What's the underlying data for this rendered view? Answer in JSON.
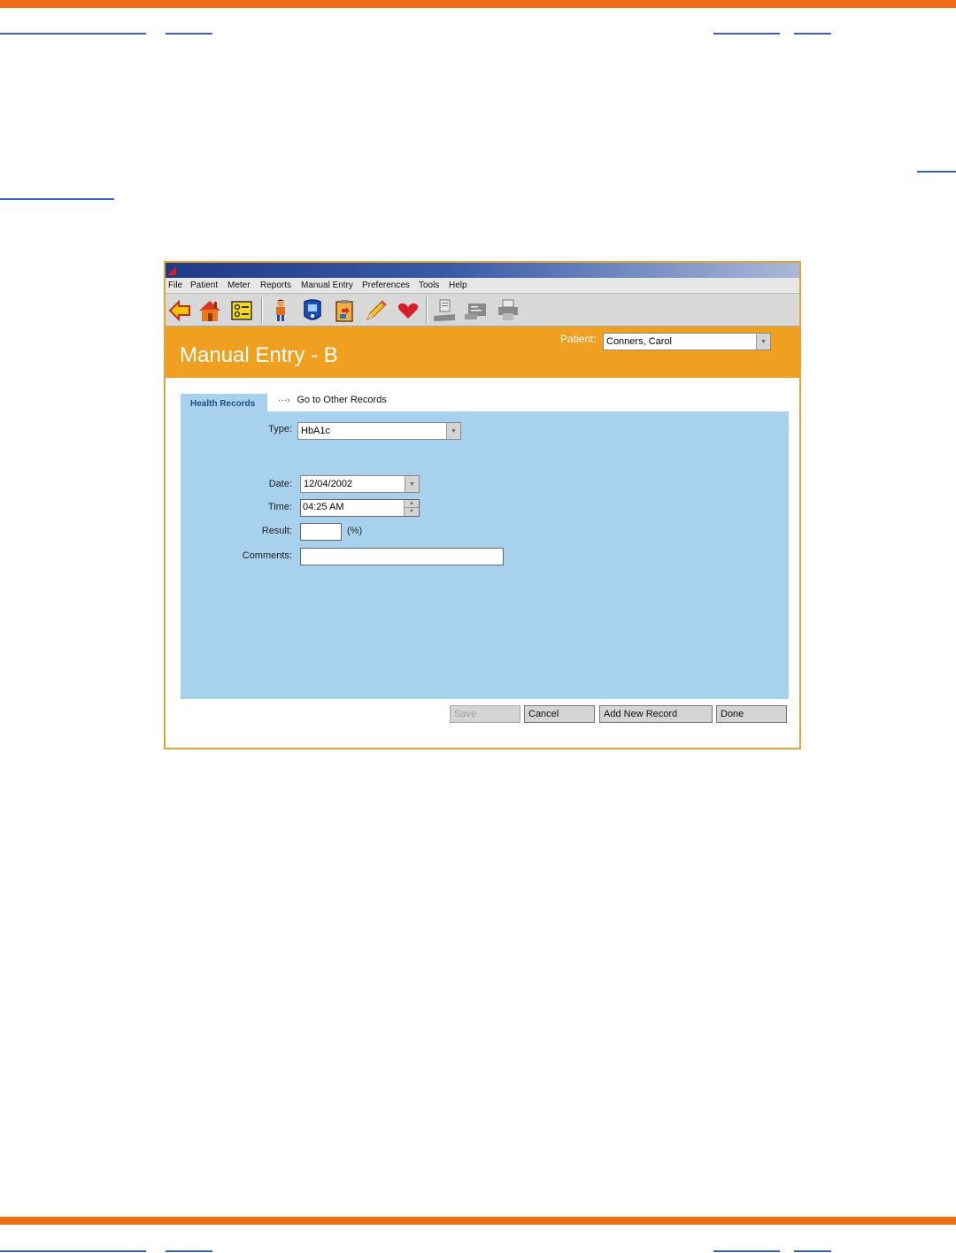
{
  "menu": [
    "File",
    "Patient",
    "Meter",
    "Reports",
    "Manual Entry",
    "Preferences",
    "Tools",
    "Help"
  ],
  "toolbar_icons": [
    "back-arrow-icon",
    "home-icon",
    "checklist-icon",
    "person-icon",
    "meter-icon",
    "clipboard-icon",
    "pencil-icon",
    "heart-icon",
    "download-icon",
    "transfer-icon",
    "printer-icon"
  ],
  "header": {
    "title": "Manual Entry - B",
    "patient_label": "Patient:",
    "patient_value": "Conners, Carol"
  },
  "tabs": {
    "active": "Health Records",
    "other_link": "Go to Other Records"
  },
  "form": {
    "type_label": "Type:",
    "type_value": "HbA1c",
    "date_label": "Date:",
    "date_value": "12/04/2002",
    "time_label": "Time:",
    "time_value": "04:25 AM",
    "result_label": "Result:",
    "result_value": "",
    "result_unit": "(%)",
    "comments_label": "Comments:",
    "comments_value": ""
  },
  "buttons": {
    "save": "Save",
    "cancel": "Cancel",
    "add_new": "Add New Record",
    "done": "Done"
  },
  "colors": {
    "accent_orange": "#f06c14",
    "header_orange": "#f0a020",
    "panel_blue": "#a8d1ee",
    "link_blue": "#3a5fc0"
  }
}
